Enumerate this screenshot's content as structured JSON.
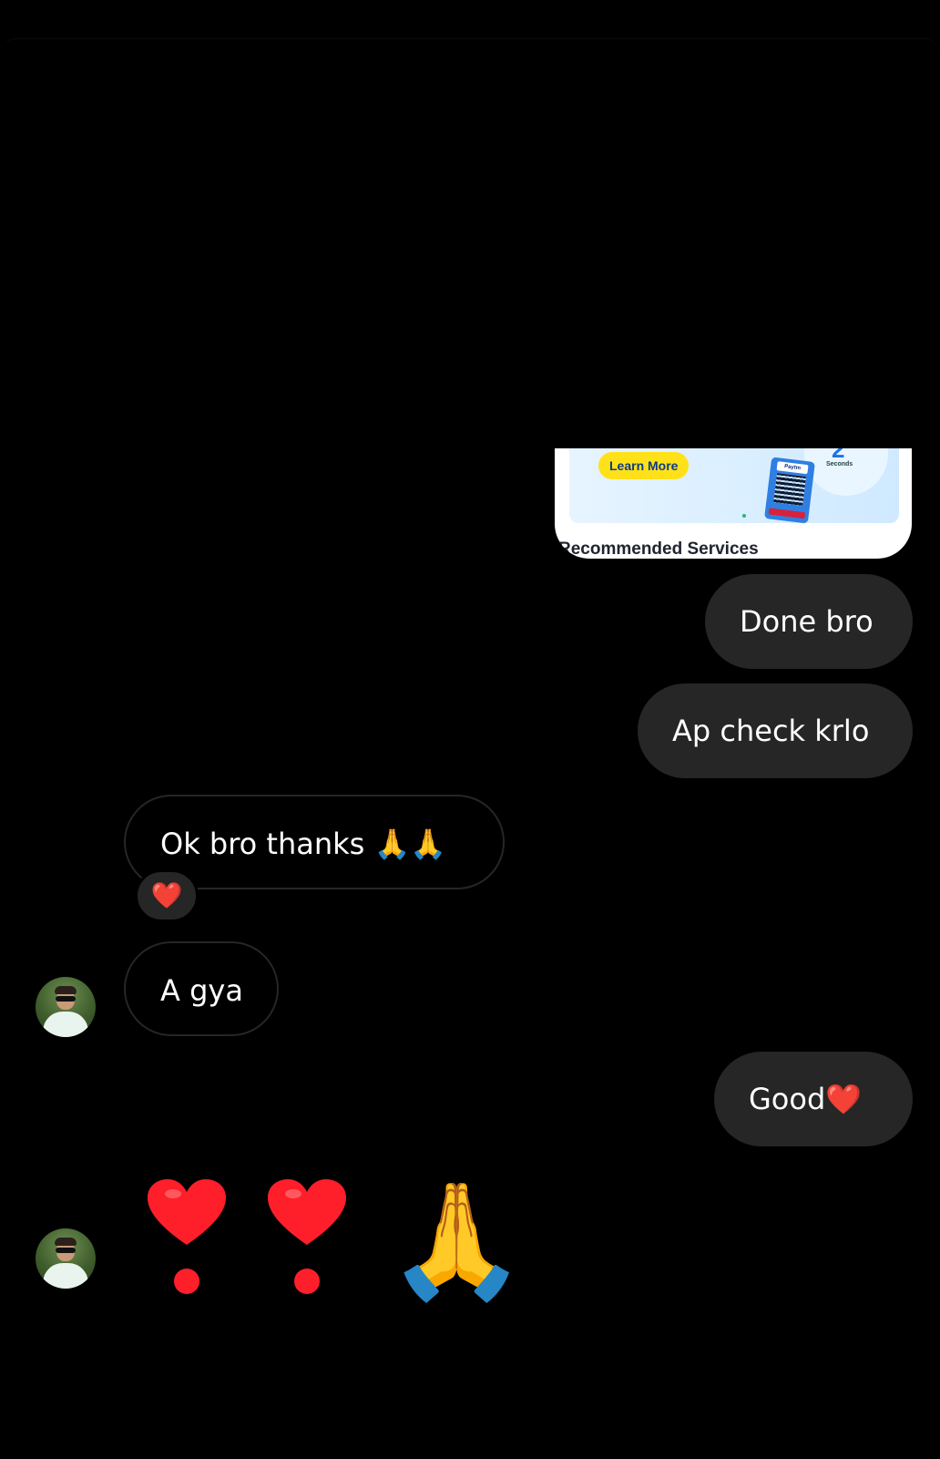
{
  "shared_image": {
    "learn_more": "Learn More",
    "paytm_label": "Paytm",
    "banner_digit": "2",
    "banner_small": "Seconds",
    "recommended_label": "Recommended Services"
  },
  "messages": [
    {
      "side": "sent",
      "text": "Done bro"
    },
    {
      "side": "sent",
      "text": "Ap check krlo"
    },
    {
      "side": "received",
      "text": "Ok bro thanks 🙏🙏",
      "reaction": "❤️"
    },
    {
      "side": "received",
      "text": "A gya"
    },
    {
      "side": "sent",
      "text": "Good❤️"
    }
  ],
  "emoji_message": {
    "text": "❣️❣️🙏",
    "icons": [
      "heart-exclamation-icon",
      "heart-exclamation-icon",
      "folded-hands-icon"
    ]
  },
  "colors": {
    "background": "#000000",
    "sent_bubble": "#262626",
    "received_border": "#262626",
    "text": "#ffffff",
    "heart": "#ff1f2a"
  }
}
